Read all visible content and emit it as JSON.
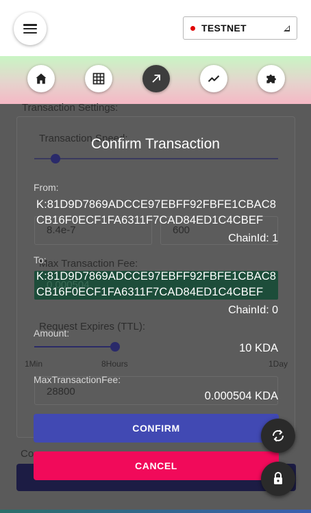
{
  "header": {
    "network": {
      "label": "TESTNET",
      "status_color": "#e00000"
    }
  },
  "nav": {
    "items": [
      {
        "icon": "home-icon",
        "active": false
      },
      {
        "icon": "grid-icon",
        "active": false
      },
      {
        "icon": "send-arrow-icon",
        "active": true
      },
      {
        "icon": "chart-line-icon",
        "active": false
      },
      {
        "icon": "puzzle-icon",
        "active": false
      }
    ]
  },
  "background_form": {
    "section_title": "Transaction Settings:",
    "speed_label": "Transaction Speed:",
    "gas_price": "8.4e-7",
    "gas_limit": "600",
    "max_fee_label": "Max Transaction Fee:",
    "max_fee_value": "0.000504",
    "ttl_label": "Request Expires (TTL):",
    "ttl_min": "1Min",
    "ttl_mid": "8Hours",
    "ttl_max": "1Day",
    "ttl_value": "28800",
    "footer_text": "Co"
  },
  "modal": {
    "title": "Confirm Transaction",
    "from_label": "From:",
    "from_account": "K:81D9D7869ADCCE97EBFF92FBFE1CBAC8CB16F0ECF1FA6311F7CAD84ED1C4CBEF",
    "from_chain": "ChainId: 1",
    "to_label": "To:",
    "to_account": "K:81D9D7869ADCCE97EBFF92FBFE1CBAC8CB16F0ECF1FA6311F7CAD84ED1C4CBEF",
    "to_chain": "ChainId: 0",
    "amount_label": "Amount:",
    "amount_value": "10 KDA",
    "fee_label": "MaxTransactionFee:",
    "fee_value": "0.000504 KDA",
    "confirm_label": "CONFIRM",
    "cancel_label": "CANCEL"
  },
  "colors": {
    "confirm": "#4149b3",
    "cancel": "#f10a5a",
    "nav_gradient_top": "#c9f5c4",
    "nav_gradient_bottom": "#f5b8c5"
  }
}
